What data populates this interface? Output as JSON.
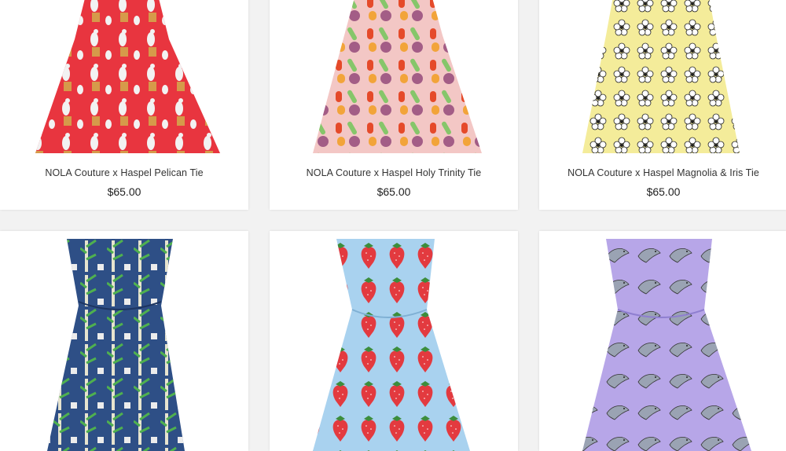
{
  "products": [
    {
      "name": "NOLA Couture x Haspel Pelican Tie",
      "price": "$65.00",
      "tie_color": "#e8353f",
      "pattern_icon": "pelican-icon"
    },
    {
      "name": "NOLA Couture x Haspel Holy Trinity Tie",
      "price": "$65.00",
      "tie_color": "#f3c7c5",
      "pattern_icon": "vegetable-icon"
    },
    {
      "name": "NOLA Couture x Haspel Magnolia & Iris Tie",
      "price": "$65.00",
      "tie_color": "#f4ec9a",
      "pattern_icon": "magnolia-icon"
    },
    {
      "name": "",
      "price": "",
      "tie_color": "#2e4f86",
      "pattern_icon": "sugarcane-icon"
    },
    {
      "name": "",
      "price": "",
      "tie_color": "#a9d2ef",
      "pattern_icon": "strawberry-icon"
    },
    {
      "name": "",
      "price": "",
      "tie_color": "#b7a6e8",
      "pattern_icon": "dolphin-icon"
    }
  ]
}
